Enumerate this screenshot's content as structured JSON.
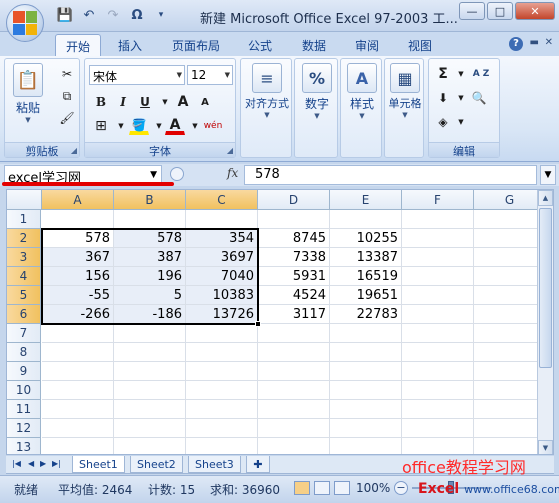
{
  "window": {
    "title": "新建 Microsoft Office Excel 97-2003 工...",
    "minimize": "—",
    "maximize": "□",
    "close": "✕"
  },
  "qat": [
    "💾",
    "↶",
    "↷",
    "Ω",
    "▾"
  ],
  "tabs": [
    "开始",
    "插入",
    "页面布局",
    "公式",
    "数据",
    "审阅",
    "视图"
  ],
  "ribbon": {
    "clipboard": {
      "label": "剪贴板",
      "paste": "粘贴"
    },
    "font": {
      "label": "字体",
      "name": "宋体",
      "size": "12",
      "bold": "B",
      "italic": "I",
      "underline": "U",
      "grow": "A",
      "shrink": "A",
      "font_color": "A",
      "phonetic": "wén"
    },
    "align": {
      "label": "对齐方式"
    },
    "number": {
      "label": "数字",
      "symbol": "%"
    },
    "style": {
      "label": "样式"
    },
    "cells": {
      "label": "单元格"
    },
    "edit": {
      "label": "编辑",
      "sum": "Σ",
      "sort": "A Z"
    }
  },
  "formula_bar": {
    "name_box": "excel学习网",
    "fx": "fx",
    "value": "578"
  },
  "columns": [
    "A",
    "B",
    "C",
    "D",
    "E",
    "F",
    "G"
  ],
  "rows": [
    "1",
    "2",
    "3",
    "4",
    "5",
    "6",
    "7",
    "8",
    "9",
    "10",
    "11",
    "12",
    "13"
  ],
  "cells": [
    [
      "",
      "",
      "",
      "",
      "",
      "",
      ""
    ],
    [
      "578",
      "578",
      "354",
      "8745",
      "10255",
      "",
      ""
    ],
    [
      "367",
      "387",
      "3697",
      "7338",
      "13387",
      "",
      ""
    ],
    [
      "156",
      "196",
      "7040",
      "5931",
      "16519",
      "",
      ""
    ],
    [
      "-55",
      "5",
      "10383",
      "4524",
      "19651",
      "",
      ""
    ],
    [
      "-266",
      "-186",
      "13726",
      "3117",
      "22783",
      "",
      ""
    ]
  ],
  "sheets": [
    "Sheet1",
    "Sheet2",
    "Sheet3"
  ],
  "watermark": "office教程学习网",
  "status": {
    "ready": "就绪",
    "average": "平均值: 2464",
    "count": "计数: 15",
    "sum": "求和: 36960",
    "zoom": "100%"
  },
  "watermark2": {
    "main": "Excel",
    "domain": "www.office68.com"
  }
}
